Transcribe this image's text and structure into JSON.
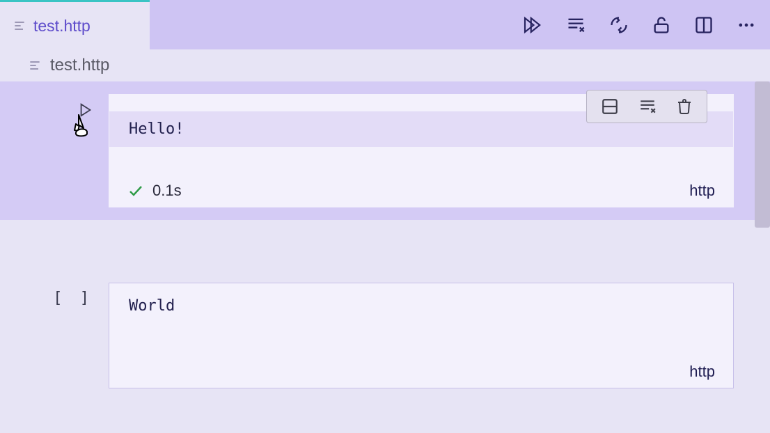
{
  "tab": {
    "label": "test.http"
  },
  "breadcrumb": {
    "file": "test.http"
  },
  "toolbar": {
    "run_all": "run-all",
    "clear_all": "clear-all",
    "compare": "compare",
    "lock": "unlock",
    "split": "split-right",
    "more": "more"
  },
  "cell_toolbar": {
    "split_cell": "split-cell",
    "clear_cell": "clear-output",
    "delete_cell": "delete-cell"
  },
  "cells": [
    {
      "code": "Hello!",
      "status_time": "0.1s",
      "language": "http",
      "state": "success"
    },
    {
      "code": "World",
      "language": "http",
      "state": "idle"
    }
  ]
}
